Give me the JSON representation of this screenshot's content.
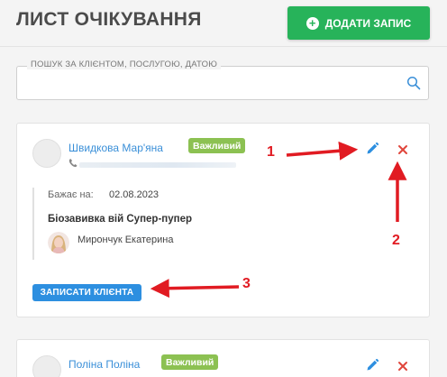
{
  "header": {
    "title": "ЛИСТ ОЧІКУВАННЯ",
    "add_button_label": "ДОДАТИ ЗАПИС",
    "add_button_color": "#27b35a"
  },
  "search": {
    "legend": "ПОШУК ЗА КЛІЄНТОМ, ПОСЛУГОЮ, ДАТОЮ",
    "value": "",
    "icon": "search-icon"
  },
  "entries": [
    {
      "client_name": "Швидкова Мар'яна",
      "badge": "Важливий",
      "badge_color": "#8cc152",
      "wanted_label": "Бажає на:",
      "wanted_date": "02.08.2023",
      "service": "Біозавивка вій Супер-пупер",
      "master": "Мирончук Екатерина",
      "book_button_label": "ЗАПИСАТИ КЛІЄНТА"
    },
    {
      "client_name": "Поліна Поліна",
      "badge": "Важливий",
      "badge_color": "#8cc152"
    }
  ],
  "annotations": {
    "callout_1": "1",
    "callout_2": "2",
    "callout_3": "3",
    "arrow_color": "#e11b22"
  }
}
